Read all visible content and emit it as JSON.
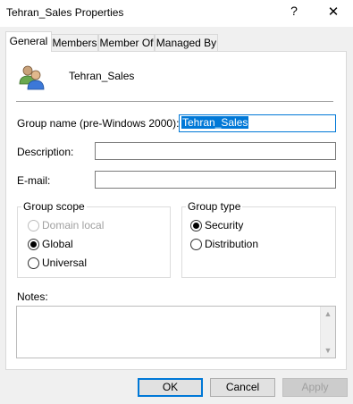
{
  "window": {
    "title": "Tehran_Sales Properties",
    "help_glyph": "?",
    "close_glyph": "✕"
  },
  "tabs": [
    {
      "label": "General",
      "active": true
    },
    {
      "label": "Members",
      "active": false
    },
    {
      "label": "Member Of",
      "active": false
    },
    {
      "label": "Managed By",
      "active": false
    }
  ],
  "general": {
    "group_display_name": "Tehran_Sales",
    "group_name_label": "Group name (pre-Windows 2000):",
    "group_name_value": "Tehran_Sales",
    "description_label": "Description:",
    "description_value": "",
    "email_label": "E-mail:",
    "email_value": "",
    "group_scope": {
      "legend": "Group scope",
      "options": [
        {
          "label": "Domain local",
          "checked": false,
          "disabled": true
        },
        {
          "label": "Global",
          "checked": true,
          "disabled": false
        },
        {
          "label": "Universal",
          "checked": false,
          "disabled": false
        }
      ]
    },
    "group_type": {
      "legend": "Group type",
      "options": [
        {
          "label": "Security",
          "checked": true,
          "disabled": false
        },
        {
          "label": "Distribution",
          "checked": false,
          "disabled": false
        }
      ]
    },
    "notes_label": "Notes:",
    "notes_value": ""
  },
  "buttons": {
    "ok": "OK",
    "cancel": "Cancel",
    "apply": "Apply"
  },
  "colors": {
    "accent": "#0078d7",
    "dialog_bg": "#f0f0f0",
    "panel_bg": "#ffffff"
  }
}
